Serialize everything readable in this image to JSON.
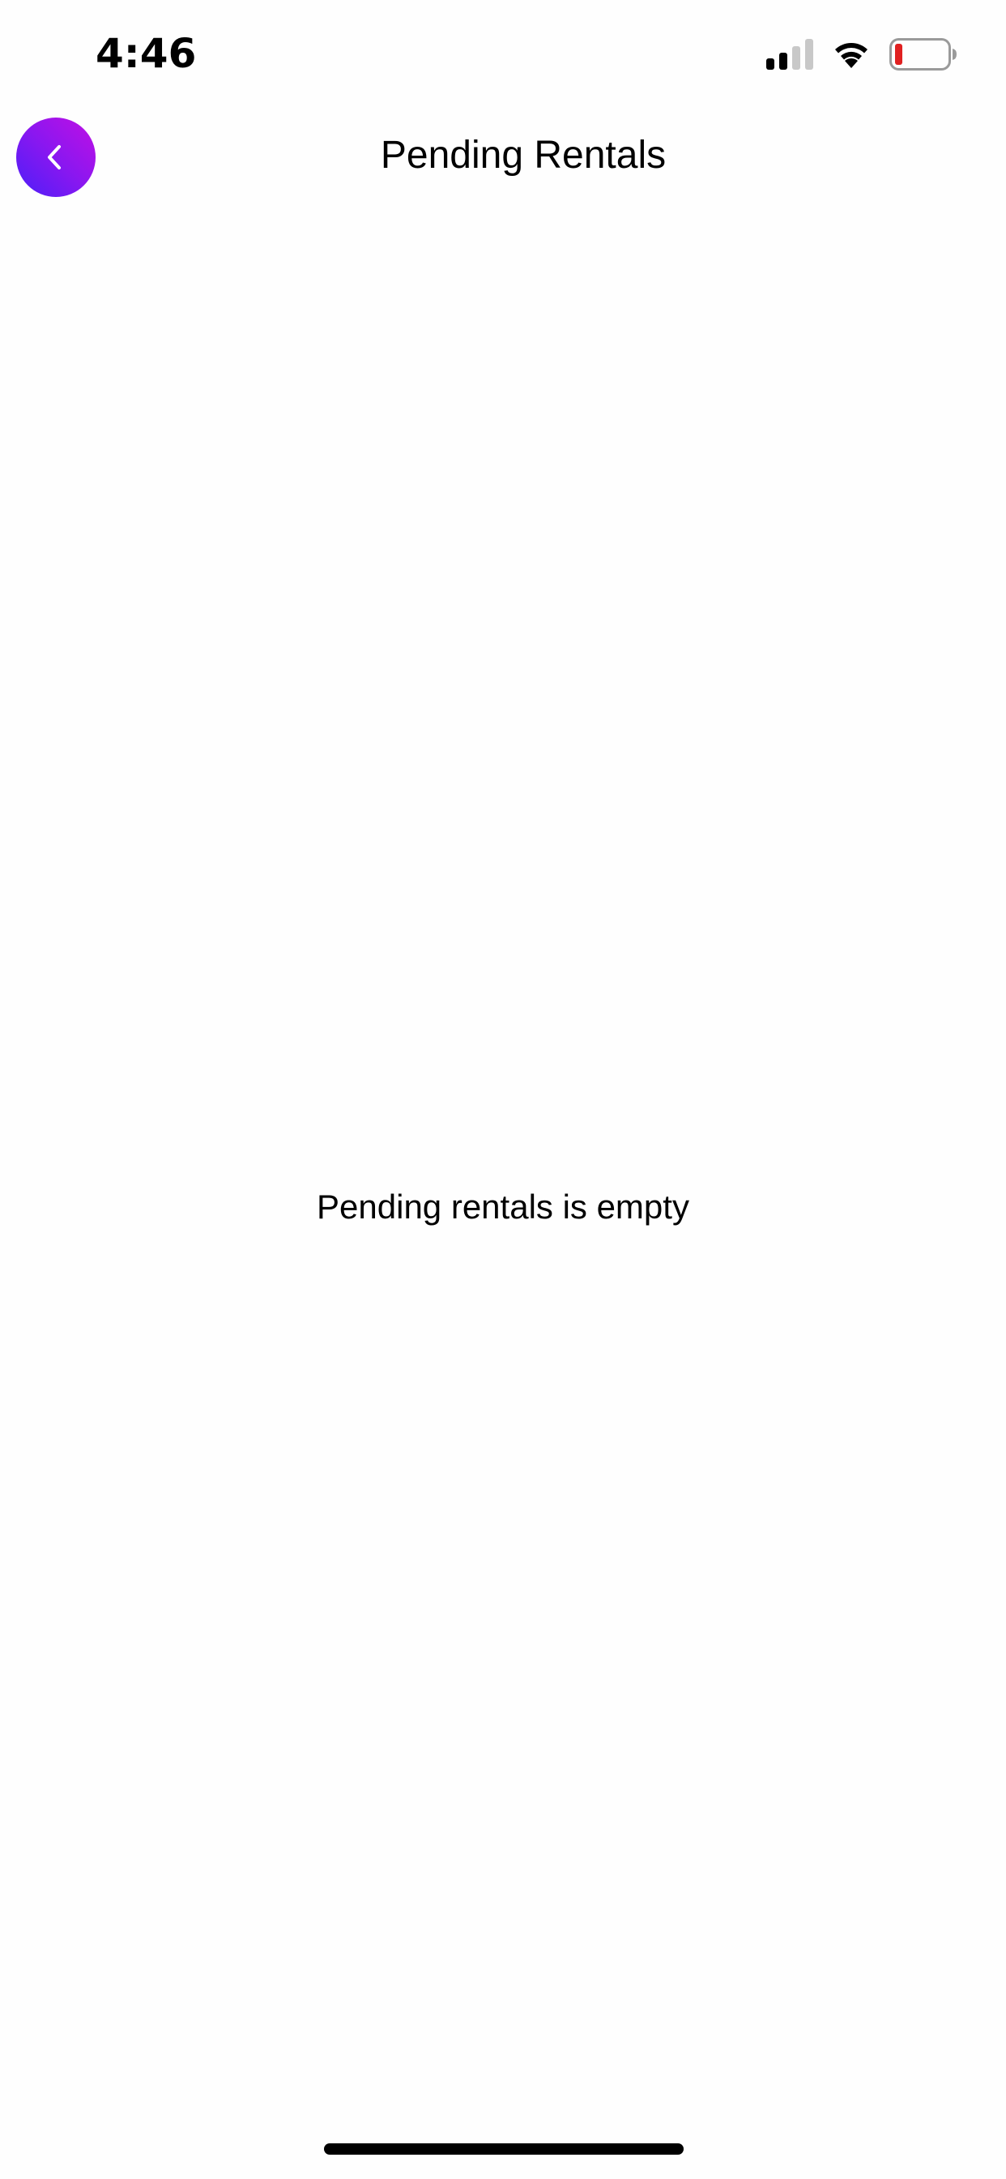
{
  "status_bar": {
    "time": "4:46",
    "icons": [
      "cellular-signal-icon",
      "wifi-icon",
      "battery-icon"
    ],
    "battery_color": "#e02020"
  },
  "header": {
    "title": "Pending Rentals",
    "back_icon": "chevron-left-icon",
    "accent_gradient": [
      "#c10fe4",
      "#4b1ff8"
    ]
  },
  "main": {
    "empty_message": "Pending rentals is empty"
  }
}
